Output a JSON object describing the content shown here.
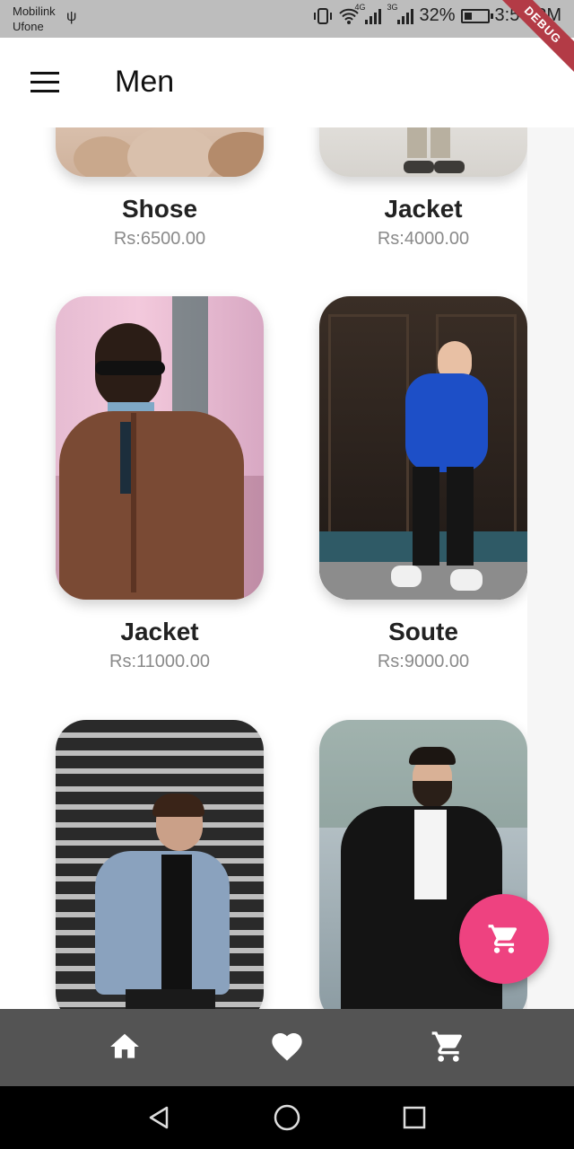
{
  "status_bar": {
    "carrier_1": "Mobilink",
    "carrier_2": "Ufone",
    "network_1": "4G",
    "network_2": "3G",
    "battery": "32%",
    "time": "3:57 PM"
  },
  "debug_banner": "DEBUG",
  "app_bar": {
    "title": "Men",
    "menu_icon": "menu-icon"
  },
  "products": [
    {
      "name": "Shose",
      "price": "Rs:6500.00"
    },
    {
      "name": "Jacket",
      "price": "Rs:4000.00"
    },
    {
      "name": "Jacket",
      "price": "Rs:11000.00"
    },
    {
      "name": "Soute",
      "price": "Rs:9000.00"
    },
    {
      "name": "",
      "price": ""
    },
    {
      "name": "",
      "price": ""
    }
  ],
  "fab": {
    "icon": "cart-icon",
    "color": "#ee4280"
  },
  "bottom_nav": {
    "items": [
      "home-icon",
      "heart-icon",
      "cart-icon"
    ],
    "background": "#545454"
  },
  "system_nav": [
    "back-icon",
    "home-circle-icon",
    "recents-icon"
  ]
}
